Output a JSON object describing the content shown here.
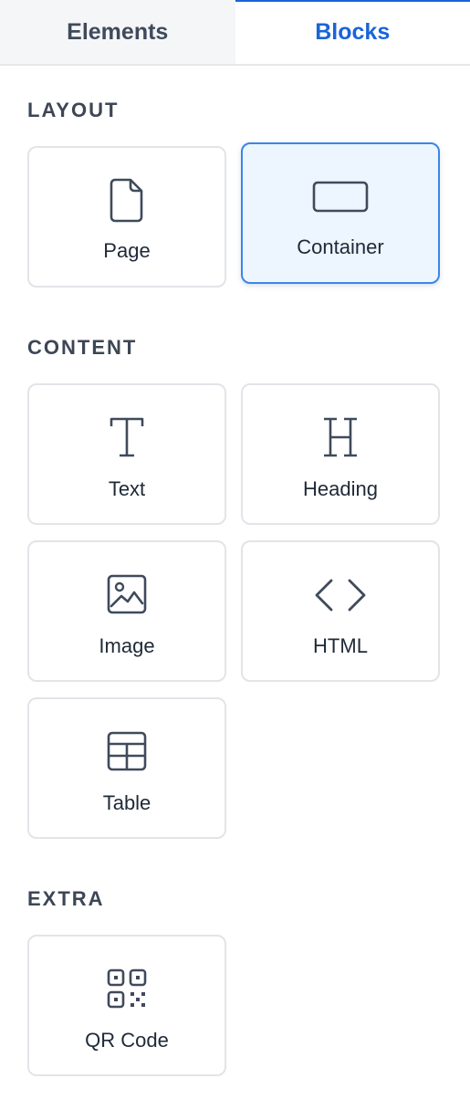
{
  "tabs": [
    {
      "label": "Elements",
      "active": false
    },
    {
      "label": "Blocks",
      "active": true
    }
  ],
  "sections": {
    "layout": {
      "title": "LAYOUT",
      "items": [
        {
          "label": "Page",
          "icon": "page-icon",
          "selected": false
        },
        {
          "label": "Container",
          "icon": "container-icon",
          "selected": true
        }
      ]
    },
    "content": {
      "title": "CONTENT",
      "items": [
        {
          "label": "Text",
          "icon": "text-icon"
        },
        {
          "label": "Heading",
          "icon": "heading-icon"
        },
        {
          "label": "Image",
          "icon": "image-icon"
        },
        {
          "label": "HTML",
          "icon": "code-icon"
        },
        {
          "label": "Table",
          "icon": "table-icon"
        }
      ]
    },
    "extra": {
      "title": "EXTRA",
      "items": [
        {
          "label": "QR Code",
          "icon": "qr-code-icon"
        }
      ]
    }
  },
  "colors": {
    "accent": "#1a64d8",
    "selected_bg": "#edf5ff",
    "selected_border": "#3b86e6",
    "card_border": "#e2e4e8",
    "icon": "#3f4a5a"
  }
}
